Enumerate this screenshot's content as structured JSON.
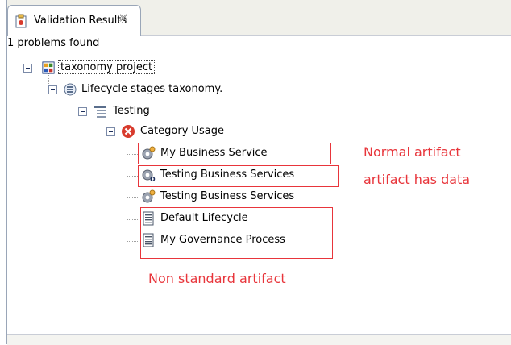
{
  "tab": {
    "title": "Validation Results"
  },
  "status": {
    "text": "1 problems found"
  },
  "tree": {
    "root": {
      "label": "taxonomy project"
    },
    "taxonomy": {
      "label": "Lifecycle stages taxonomy."
    },
    "stage": {
      "label": "Testing"
    },
    "category": {
      "label": "Category Usage"
    },
    "items": [
      {
        "label": "My Business Service",
        "icon": "service-gear-icon"
      },
      {
        "label": "Testing Business Services",
        "icon": "service-gear-data-icon"
      },
      {
        "label": "Testing Business Services",
        "icon": "service-gear-icon"
      },
      {
        "label": "Default Lifecycle",
        "icon": "document-icon"
      },
      {
        "label": "My Governance Process",
        "icon": "document-icon"
      }
    ]
  },
  "annotations": {
    "normal": "Normal artifact",
    "has_data": "artifact has data",
    "non_standard": "Non standard artifact"
  },
  "colors": {
    "annotation": "#e8353b",
    "error": "#d83b2d"
  }
}
